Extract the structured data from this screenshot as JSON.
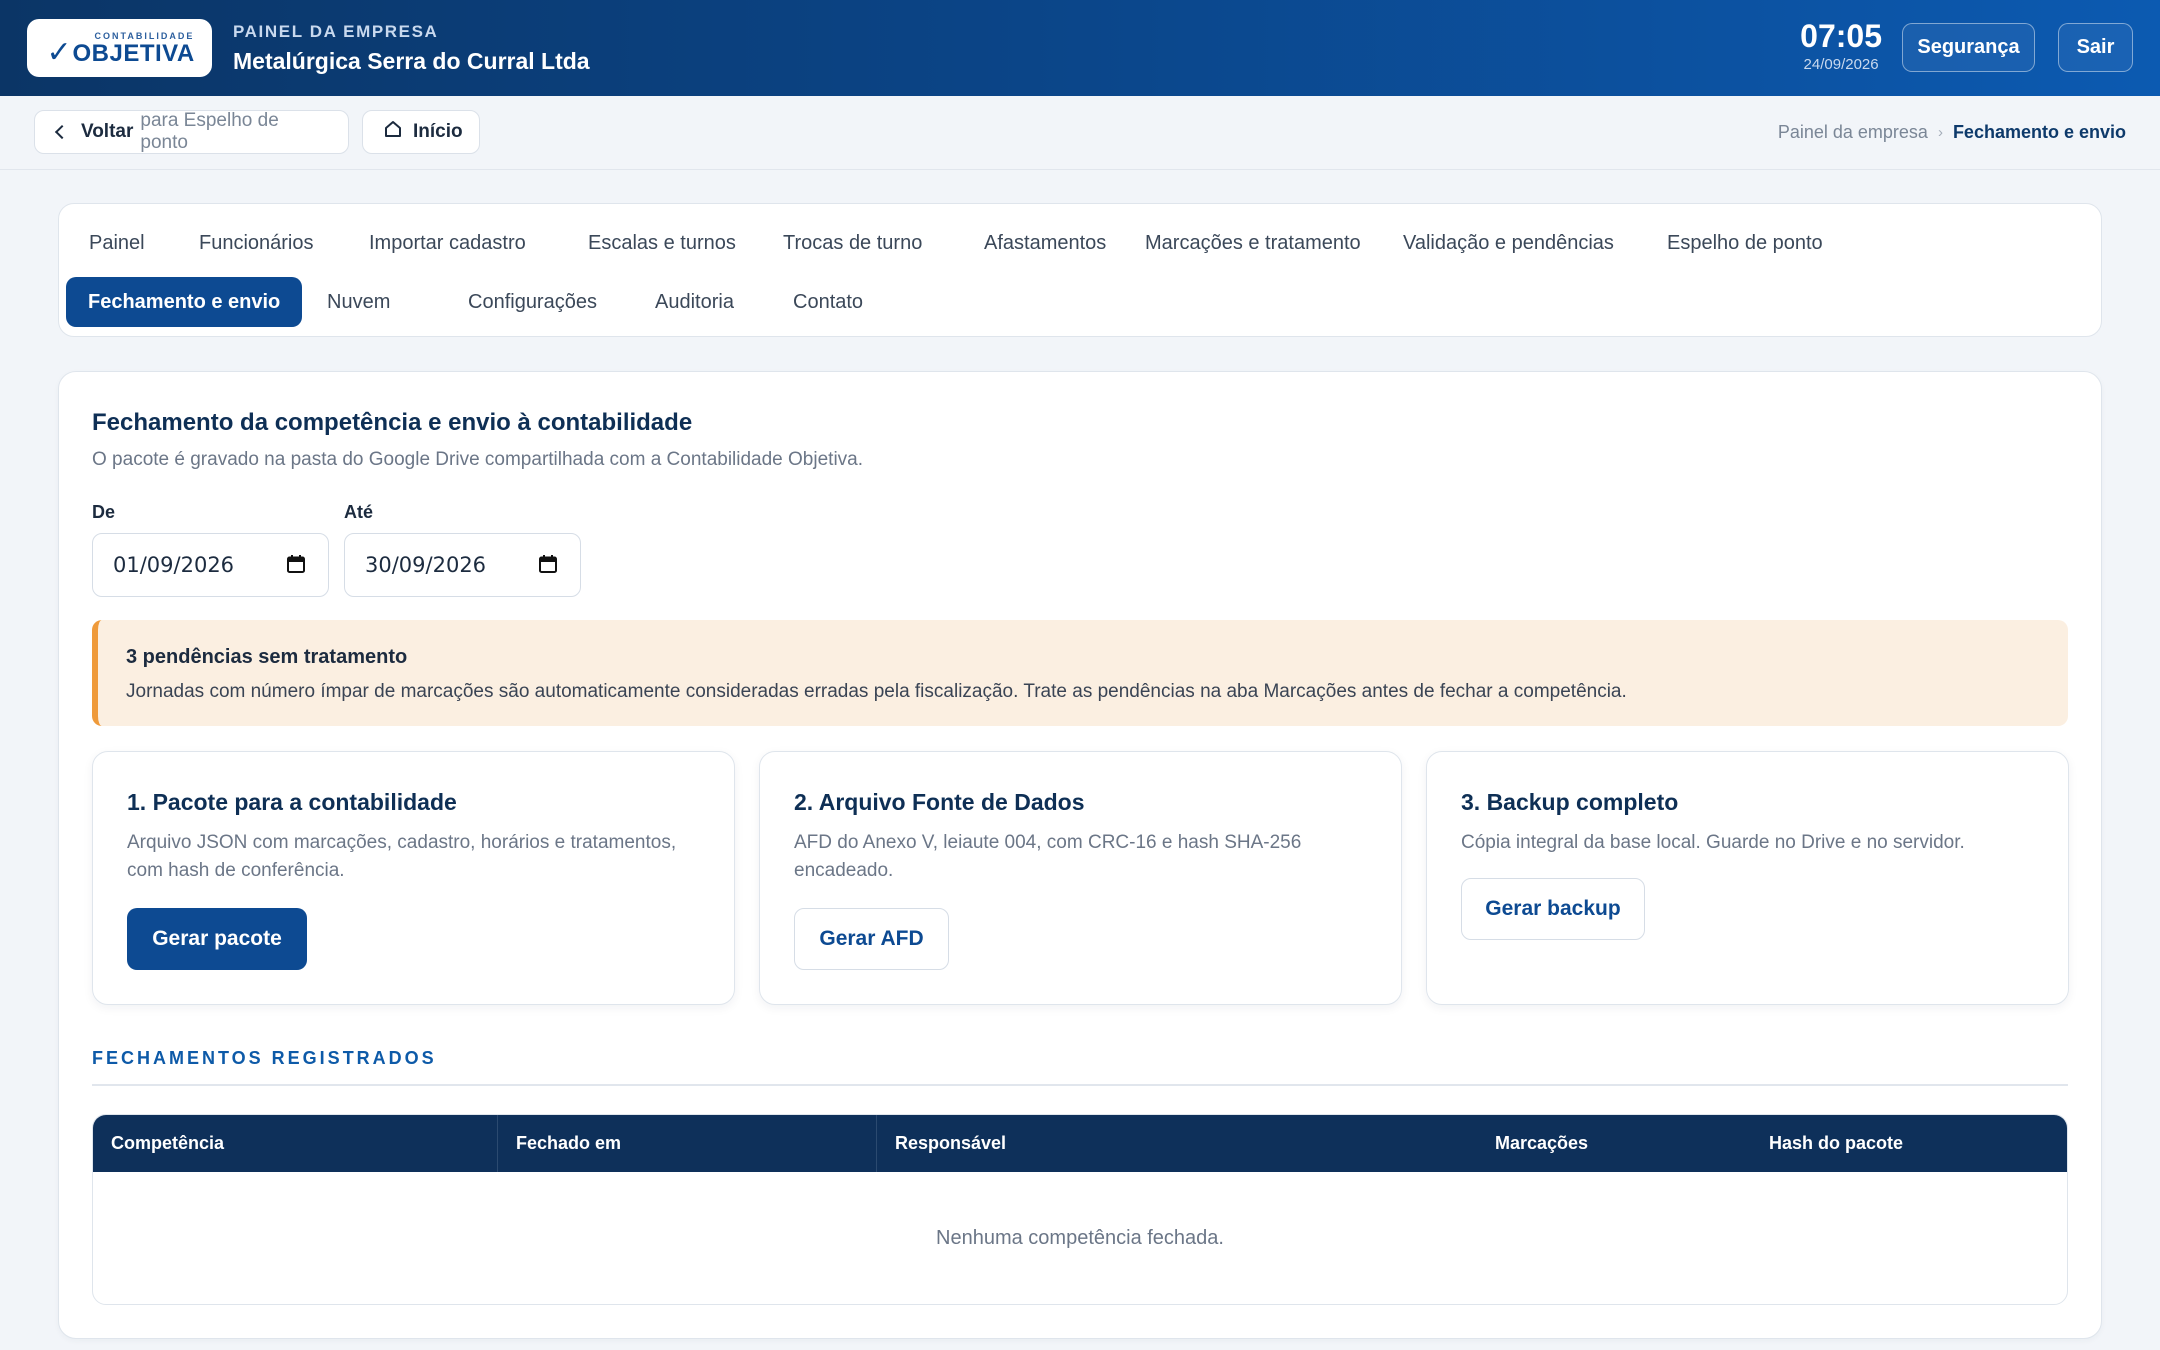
{
  "header": {
    "logo_small": "CONTABILIDADE",
    "logo_big": "OBJETIVA",
    "kicker": "PAINEL DA EMPRESA",
    "company": "Metalúrgica Serra do Curral Ltda",
    "time": "07:05",
    "date": "24/09/2026",
    "security_label": "Segurança",
    "exit_label": "Sair"
  },
  "subbar": {
    "back_label": "Voltar",
    "back_target": "para Espelho de ponto",
    "home_label": "Início",
    "breadcrumb": [
      "Painel da empresa",
      "Fechamento e envio"
    ]
  },
  "tabs": {
    "row1": [
      "Painel",
      "Funcionários",
      "Importar cadastro",
      "Escalas e turnos",
      "Trocas de turno",
      "Afastamentos",
      "Marcações e tratamento",
      "Validação e pendências",
      "Espelho de ponto"
    ],
    "row2": [
      "Fechamento e envio",
      "Nuvem",
      "Configurações",
      "Auditoria",
      "Contato"
    ],
    "active": "Fechamento e envio"
  },
  "main": {
    "title": "Fechamento da competência e envio à contabilidade",
    "subtitle": "O pacote é gravado na pasta do Google Drive compartilhada com a Contabilidade Objetiva.",
    "from_label": "De",
    "from_value": "01/09/2026",
    "to_label": "Até",
    "to_value": "30/09/2026",
    "alert": {
      "title": "3 pendências sem tratamento",
      "text": "Jornadas com número ímpar de marcações são automaticamente consideradas erradas pela fiscalização. Trate as pendências na aba Marcações antes de fechar a competência.",
      "accent": "#ef9a3a"
    },
    "steps": [
      {
        "title": "1. Pacote para a contabilidade",
        "desc": "Arquivo JSON com marcações, cadastro, horários e tratamentos, com hash de conferência.",
        "button": "Gerar pacote"
      },
      {
        "title": "2. Arquivo Fonte de Dados",
        "desc": "AFD do Anexo V, leiaute 004, com CRC-16 e hash SHA-256 encadeado.",
        "button": "Gerar AFD"
      },
      {
        "title": "3. Backup completo",
        "desc": "Cópia integral da base local. Guarde no Drive e no servidor.",
        "button": "Gerar backup"
      }
    ],
    "closures_title": "FECHAMENTOS REGISTRADOS",
    "table": {
      "columns": [
        "Competência",
        "Fechado em",
        "Responsável",
        "Marcações",
        "Hash do pacote"
      ],
      "empty": "Nenhuma competência fechada."
    }
  },
  "colors": {
    "brand": "#0d4a92",
    "table_header": "#0e305a",
    "alert_bg": "#fbefe1"
  }
}
